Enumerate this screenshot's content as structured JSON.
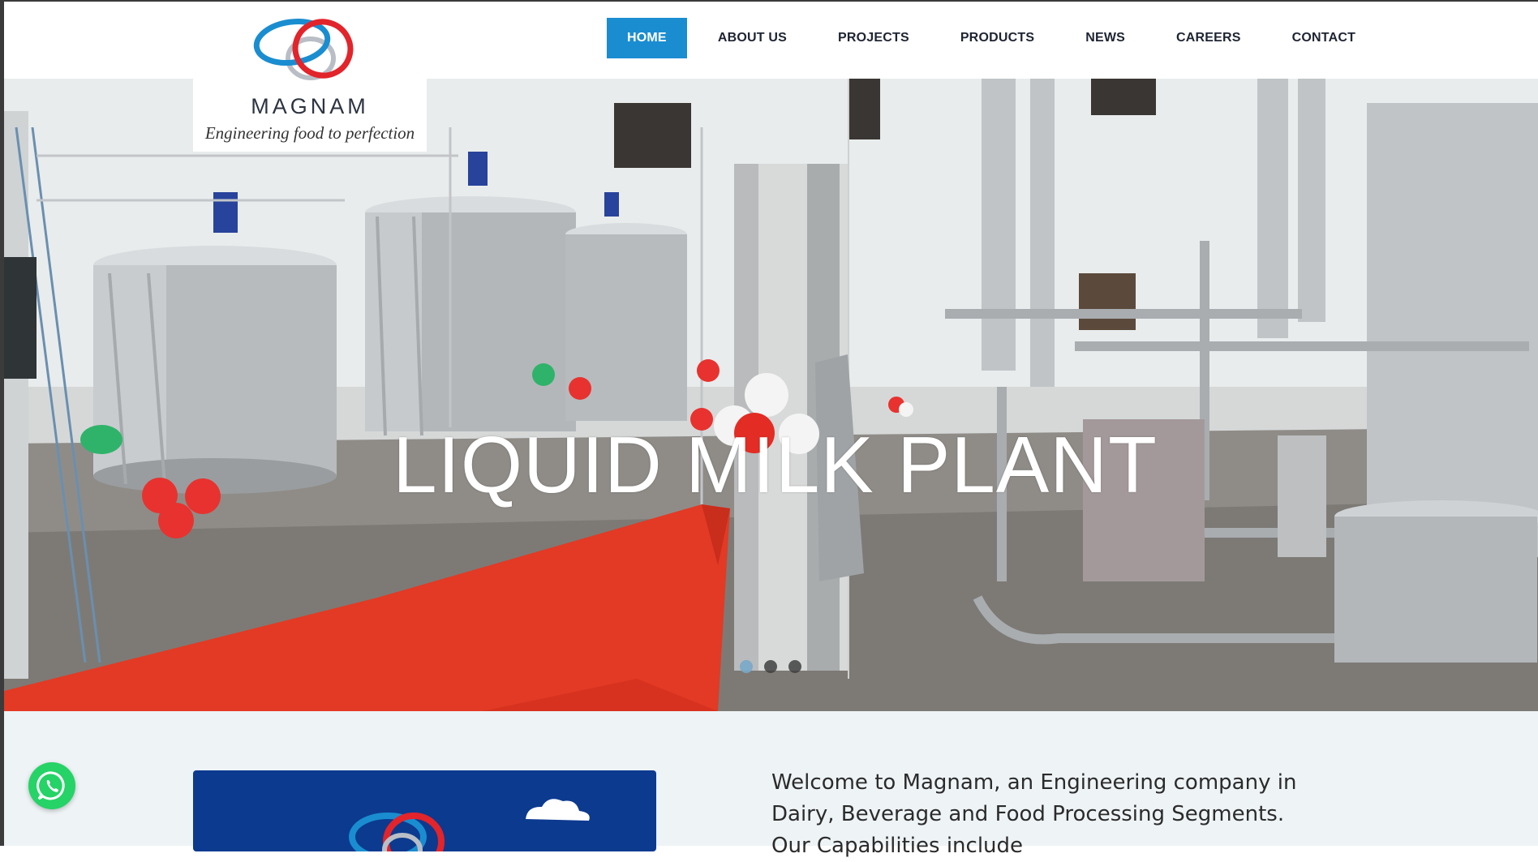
{
  "brand": {
    "name": "MAGNAM",
    "tagline": "Engineering food to perfection",
    "colors": {
      "blue": "#1a8dd0",
      "red": "#e2242b",
      "grey": "#b9bec6"
    }
  },
  "nav": {
    "items": [
      {
        "label": "HOME",
        "active": true
      },
      {
        "label": "ABOUT US",
        "active": false
      },
      {
        "label": "PROJECTS",
        "active": false
      },
      {
        "label": "PRODUCTS",
        "active": false
      },
      {
        "label": "NEWS",
        "active": false
      },
      {
        "label": "CAREERS",
        "active": false
      },
      {
        "label": "CONTACT",
        "active": false
      }
    ]
  },
  "hero": {
    "slide_title": "LIQUID MILK PLANT",
    "slide_count": 3,
    "active_slide": 1
  },
  "intro": {
    "welcome_line1": "Welcome to Magnam, an Engineering company in",
    "welcome_line2": "Dairy, Beverage and Food Processing Segments.",
    "welcome_line3": "Our Capabilities include"
  },
  "icons": {
    "whatsapp": "whatsapp-icon",
    "cloud": "cloud-icon"
  }
}
